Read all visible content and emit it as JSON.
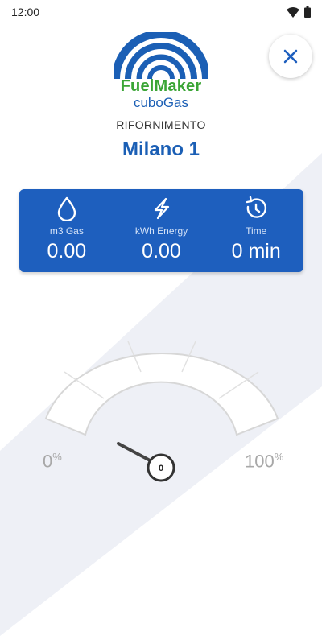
{
  "status_bar": {
    "time": "12:00"
  },
  "brand": {
    "name": "FuelMaker",
    "sub": "cuboGas"
  },
  "screen": {
    "section": "RIFORNIMENTO",
    "station": "Milano 1"
  },
  "stats": [
    {
      "icon": "drop-icon",
      "label": "m3 Gas",
      "value": "0.00"
    },
    {
      "icon": "lightning-icon",
      "label": "kWh Energy",
      "value": "0.00"
    },
    {
      "icon": "timer-icon",
      "label": "Time",
      "value": "0 min"
    }
  ],
  "gauge": {
    "min_label": "0",
    "max_label": "100",
    "unit": "%",
    "value": "0",
    "fill_fraction": 0
  },
  "colors": {
    "primary": "#1e5fbe",
    "brand_green": "#3aa535",
    "stripe": "#eef0f6"
  }
}
